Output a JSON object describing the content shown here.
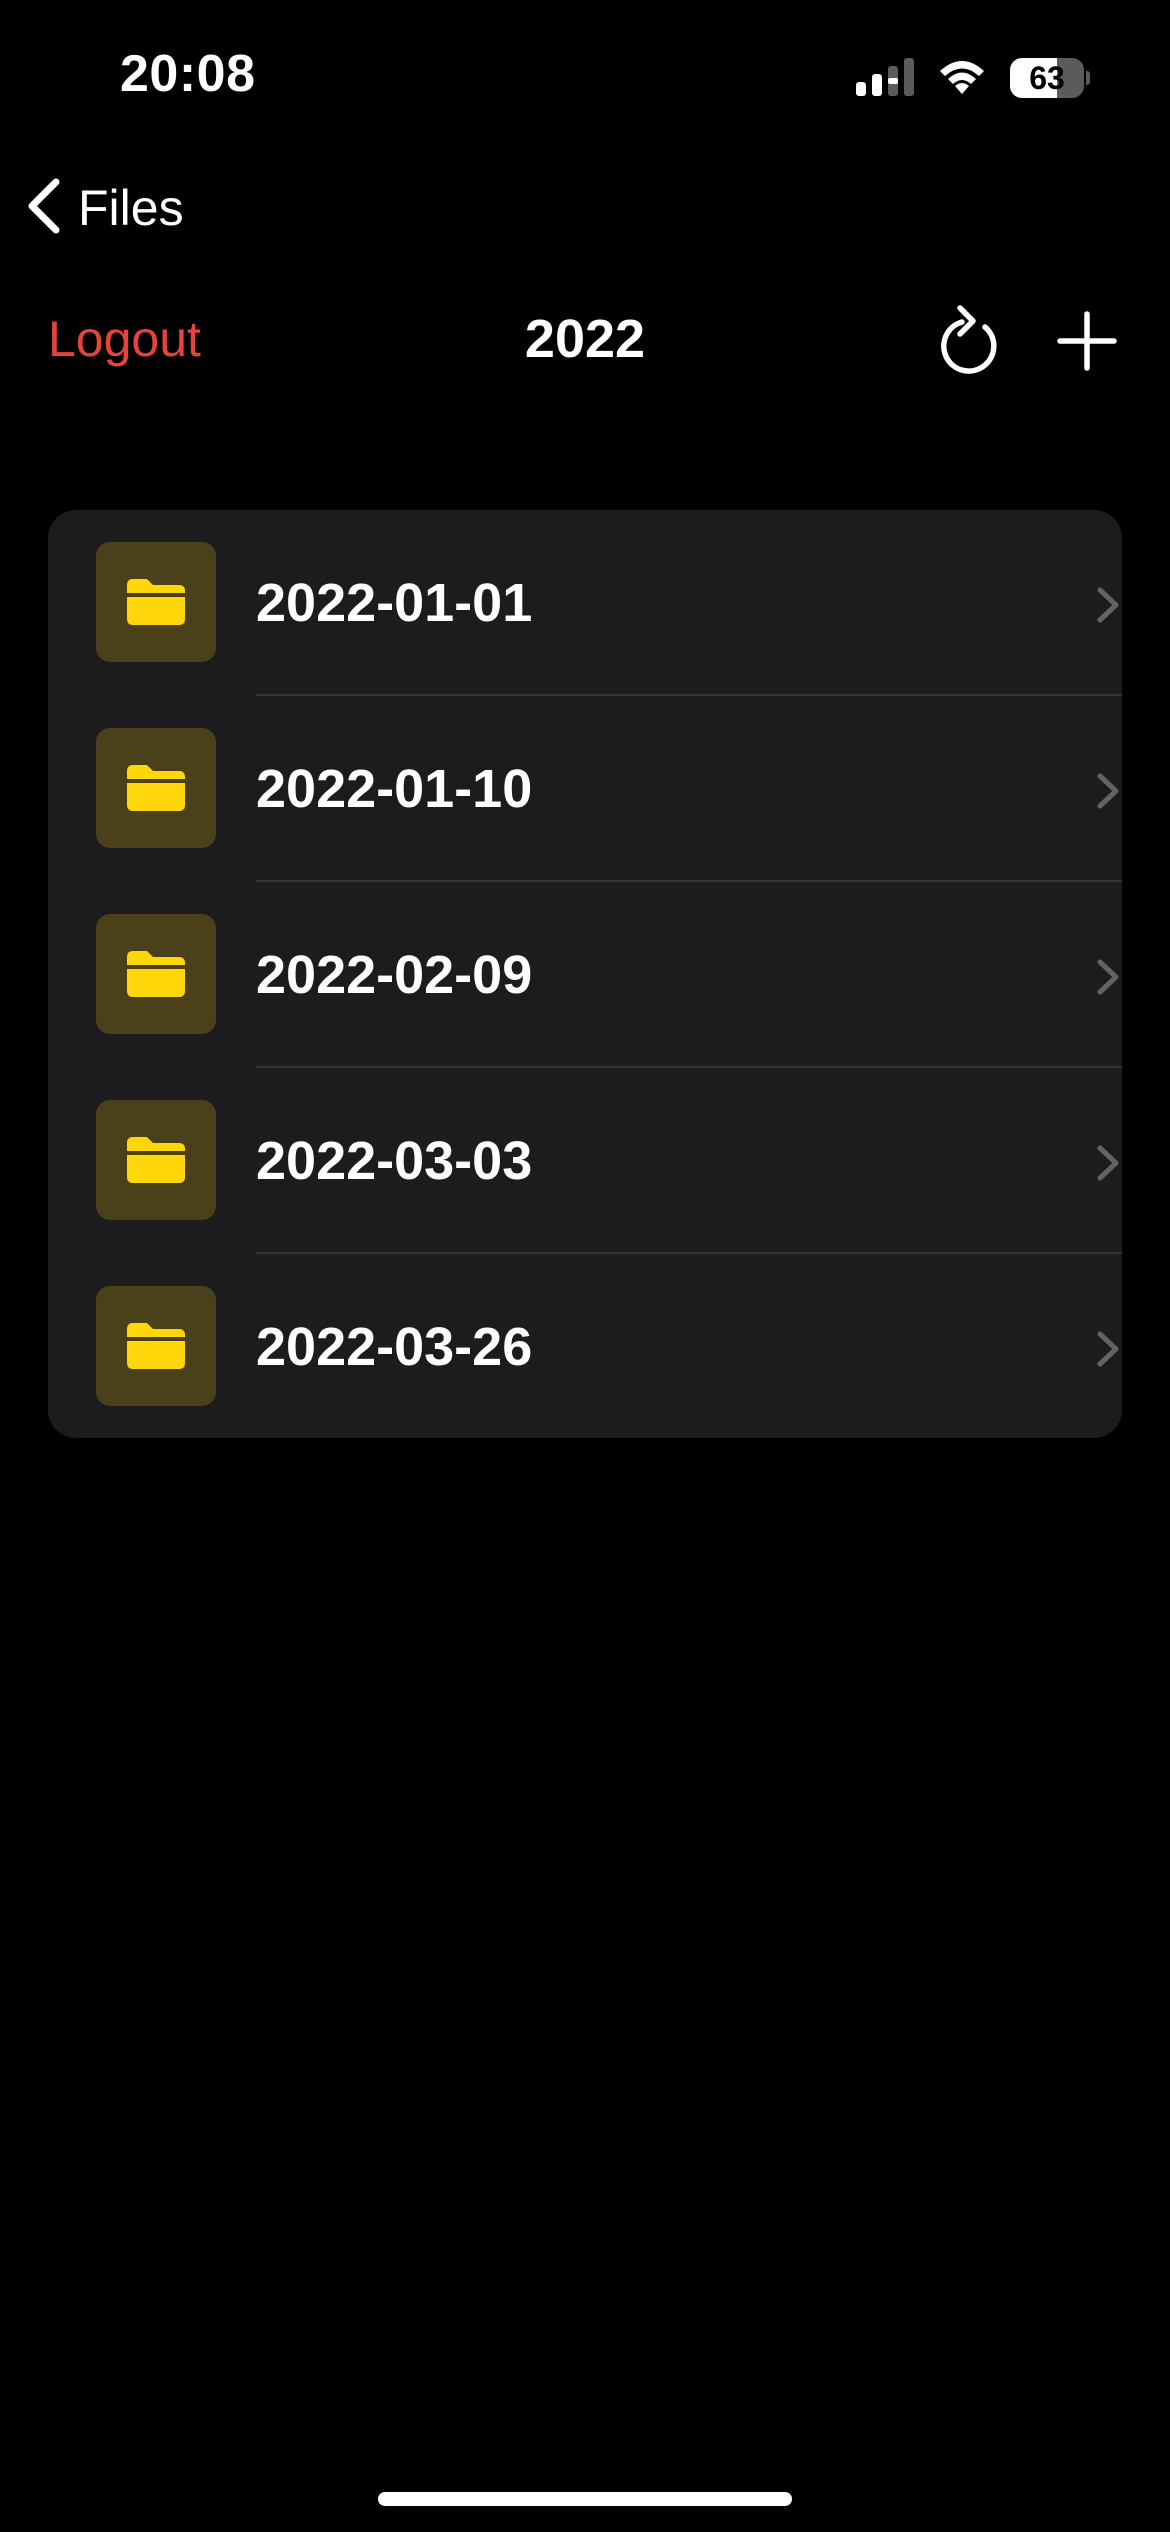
{
  "status_bar": {
    "time": "20:08",
    "battery_percent": "63",
    "battery_level": 0.63,
    "icons": [
      "cellular-signal-icon",
      "wifi-icon",
      "battery-icon"
    ]
  },
  "nav": {
    "back_label": "Files",
    "back_icon": "chevron-left-icon"
  },
  "toolbar": {
    "logout_label": "Logout",
    "title": "2022",
    "refresh_icon": "refresh-icon",
    "add_icon": "plus-icon"
  },
  "folders": [
    {
      "name": "2022-01-01",
      "icon": "folder-icon"
    },
    {
      "name": "2022-01-10",
      "icon": "folder-icon"
    },
    {
      "name": "2022-02-09",
      "icon": "folder-icon"
    },
    {
      "name": "2022-03-03",
      "icon": "folder-icon"
    },
    {
      "name": "2022-03-26",
      "icon": "folder-icon"
    }
  ],
  "colors": {
    "background": "#000000",
    "card": "#1c1c1e",
    "accent_red": "#e5433d",
    "folder_yellow": "#ffd60a",
    "folder_tile": "#4a4019",
    "chevron": "#636366",
    "divider": "#343437"
  }
}
